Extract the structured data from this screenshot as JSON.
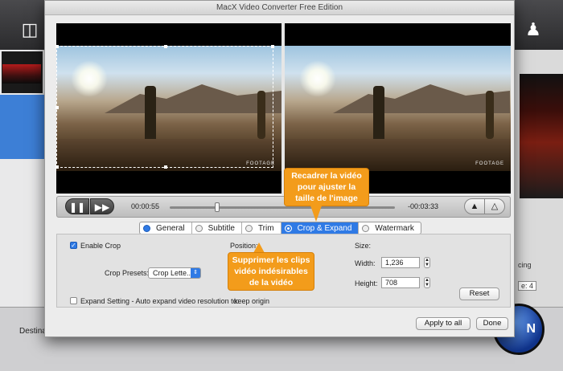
{
  "window": {
    "title": "MacX Video Converter Free Edition"
  },
  "background": {
    "destination_label": "Destina",
    "run_button_label": "N",
    "right_text_1": "cing",
    "right_select_value": "e: 4",
    "icons": [
      "add-video-icon",
      "users-icon"
    ]
  },
  "playback": {
    "current_time": "00:00:55",
    "remaining_time": "-00:03:33",
    "progress_fraction": 0.2,
    "preview_watermark": "FOOTAGE"
  },
  "tabs": [
    {
      "label": "General",
      "active": false
    },
    {
      "label": "Subtitle",
      "active": false
    },
    {
      "label": "Trim",
      "active": false
    },
    {
      "label": "Crop & Expand",
      "active": true
    },
    {
      "label": "Watermark",
      "active": false
    }
  ],
  "crop": {
    "enable_label": "Enable Crop",
    "enable_checked": true,
    "position_label": "Position:",
    "presets_label": "Crop Presets:",
    "presets_value": "Crop Lette...",
    "size_label": "Size:",
    "width_label": "Width:",
    "width_value": "1,236",
    "height_label": "Height:",
    "height_value": "708",
    "reset_label": "Reset",
    "expand_label": "Expand Setting - Auto expand video resolution to:",
    "expand_checked": false,
    "expand_value": "keep origin"
  },
  "buttons": {
    "apply_all": "Apply to all",
    "done": "Done"
  },
  "callouts": {
    "crop_note": "Recadrer la vidéo pour ajuster la taille de l'image",
    "trim_note": "Supprimer les clips vidéo indésirables de la vidéo"
  },
  "colors": {
    "accent": "#2f7ae5",
    "callout": "#f39c1b"
  }
}
